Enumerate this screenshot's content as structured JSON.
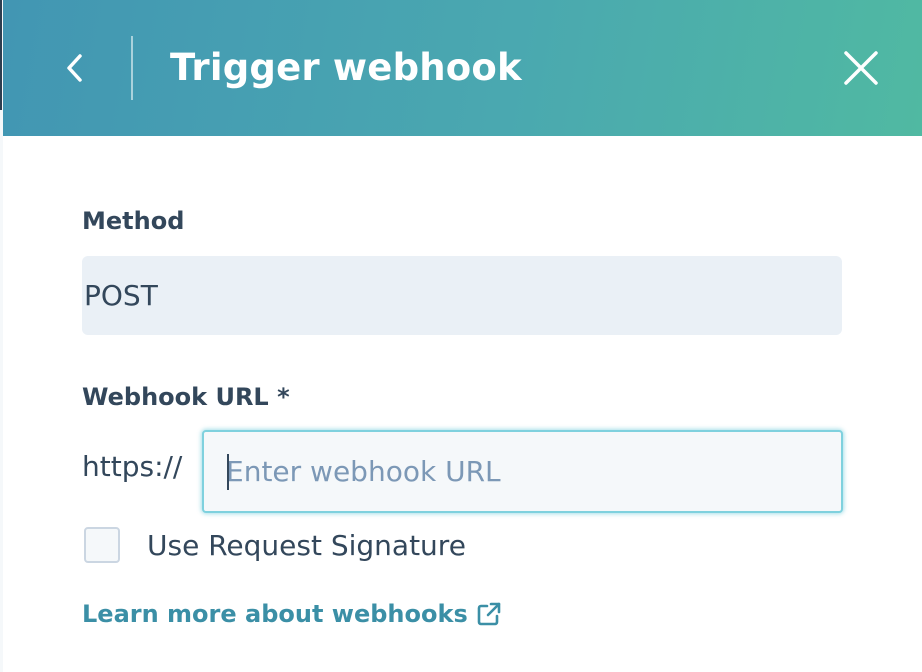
{
  "panel": {
    "title": "Trigger webhook",
    "back_icon": "chevron-left-icon",
    "close_icon": "close-icon"
  },
  "method": {
    "label": "Method",
    "value": "POST"
  },
  "webhook_url": {
    "label": "Webhook URL *",
    "prefix": "https://",
    "value": "",
    "placeholder": "Enter webhook URL"
  },
  "request_signature": {
    "label": "Use Request Signature",
    "checked": false
  },
  "learn_more": {
    "label": "Learn more about webhooks",
    "icon": "external-link-icon"
  },
  "colors": {
    "header_gradient_start": "#4296b3",
    "header_gradient_end": "#50b9a2",
    "text": "#33475b",
    "link": "#3b8fa6",
    "input_focus_border": "#7fd1de",
    "readonly_field_bg": "#eaf0f6"
  }
}
